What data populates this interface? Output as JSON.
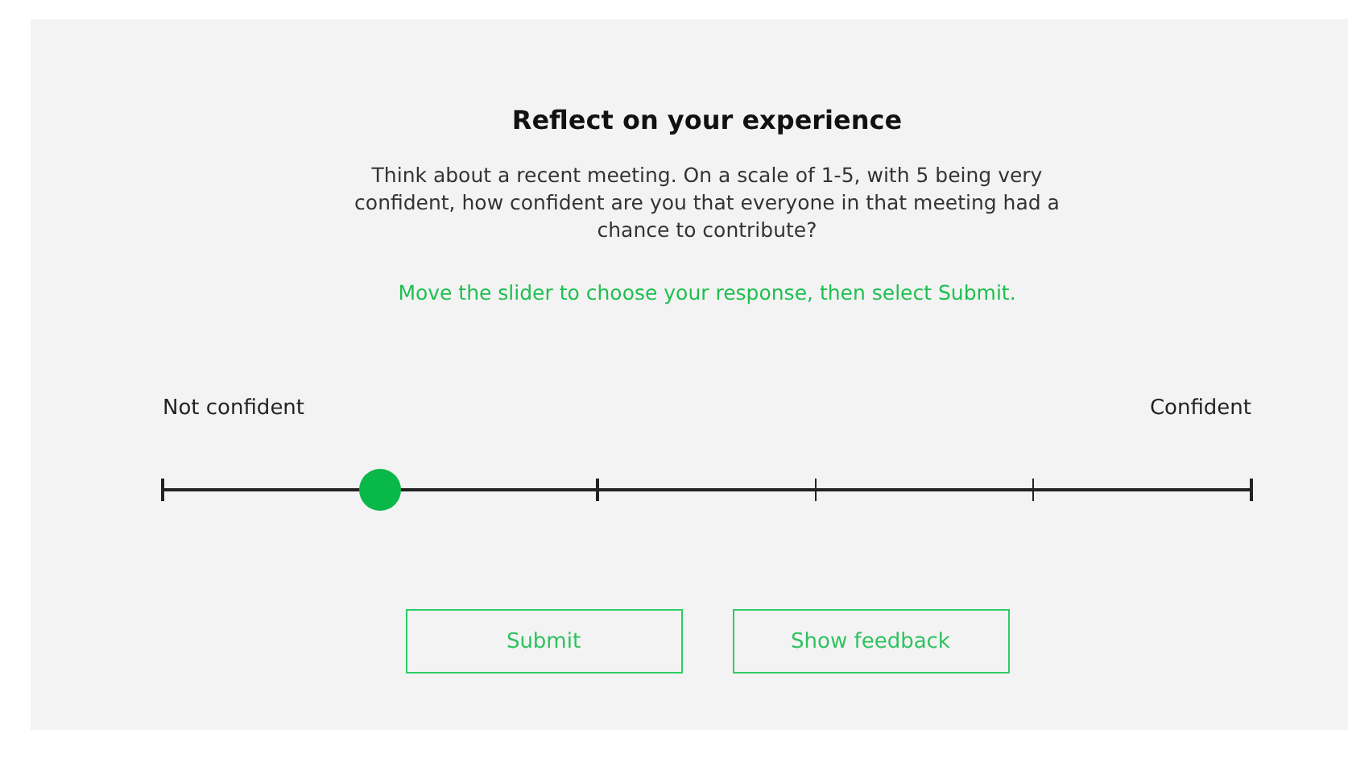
{
  "title": "Reflect on your experience",
  "question": "Think about a recent meeting. On a scale of 1-5, with 5 being very confident, how confident are you that everyone in that meeting had a chance to contribute?",
  "instruction": "Move the slider to choose your response, then select Submit.",
  "slider": {
    "min_label": "Not confident",
    "max_label": "Confident",
    "level": 0.2
  },
  "buttons": [
    {
      "label": "Submit"
    },
    {
      "label": "Show feedback"
    }
  ]
}
